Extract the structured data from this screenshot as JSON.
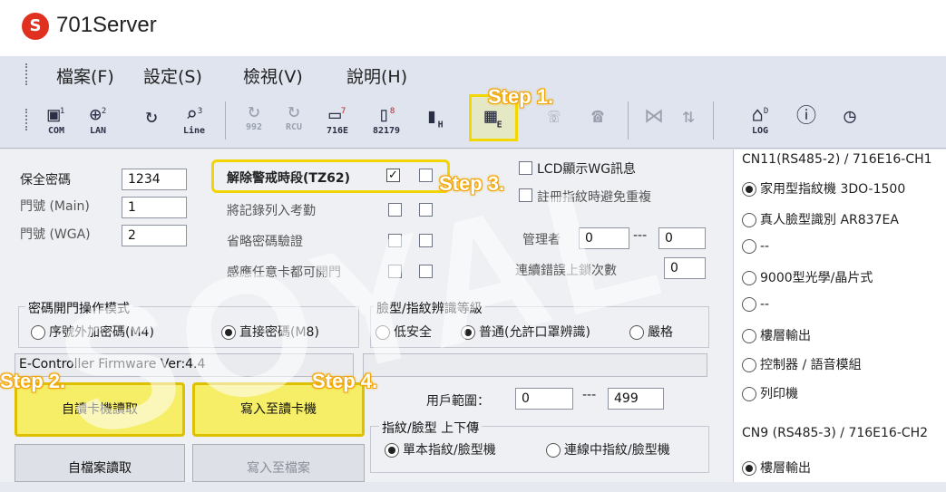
{
  "app": {
    "title": "701Server",
    "logo_letter": "S"
  },
  "menu": [
    "檔案(F)",
    "設定(S)",
    "檢視(V)",
    "說明(H)"
  ],
  "toolbar": {
    "com": {
      "label": "COM",
      "badge": "1"
    },
    "lan": {
      "label": "LAN",
      "badge": "2"
    },
    "line": {
      "label": "Line",
      "badge": "3"
    },
    "b992": {
      "label": "992"
    },
    "rcu": {
      "label": "RCU"
    },
    "e716": {
      "label": "716E",
      "badge": "7"
    },
    "e82179": {
      "label": "82179",
      "badge": "8"
    },
    "h_badge": "H",
    "e_badge": "E",
    "log": {
      "label": "LOG",
      "badge": "D"
    }
  },
  "steps": {
    "step1": "Step 1.",
    "step2": "Step 2.",
    "step3": "Step 3.",
    "step4": "Step 4."
  },
  "form": {
    "password_label": "保全密碼",
    "password_value": "1234",
    "door_main_label": "門號 (Main)",
    "door_main_value": "1",
    "door_wga_label": "門號 (WGA)",
    "door_wga_value": "2",
    "opt_disarm": "解除警戒時段(TZ62)",
    "opt_attendance": "將記錄列入考勤",
    "opt_skip_pwd": "省略密碼驗證",
    "opt_any_card": "感應任意卡都可開門",
    "lcd_wg": "LCD顯示WG訊息",
    "no_dup_fp": "註冊指紋時避免重複",
    "admin_label": "管理者",
    "admin_from": "0",
    "admin_to": "0",
    "range_sep": "---",
    "lock_label": "連續錯誤上鎖次數",
    "lock_value": "0"
  },
  "pwd_mode": {
    "title": "密碼開門操作模式",
    "opt1": "序號外加密碼(M4)",
    "opt2": "直接密碼(M8)",
    "selected": "opt2"
  },
  "face_level": {
    "title": "臉型/指紋辨識等級",
    "low": "低安全",
    "normal": "普通(允許口罩辨識)",
    "strict": "嚴格",
    "selected": "normal"
  },
  "firmware": "E-Controller Firmware Ver:4.4",
  "buttons": {
    "read_from_reader": "自讀卡機讀取",
    "write_to_reader": "寫入至讀卡機",
    "read_from_file": "自檔案讀取",
    "write_to_file": "寫入至檔案"
  },
  "user_range": {
    "label": "用戶範圍：",
    "from": "0",
    "sep": "---",
    "to": "499"
  },
  "transfer": {
    "title": "指紋/臉型 上下傳",
    "single": "單本指紋/臉型機",
    "online": "連線中指紋/臉型機",
    "selected": "single"
  },
  "right_panel": {
    "cn11_title": "CN11(RS485-2) / 716E16-CH1",
    "cn11_options": [
      "家用型指紋機 3DO-1500",
      "真人臉型識別 AR837EA",
      "--",
      "9000型光學/晶片式",
      "--",
      "樓層輸出",
      "控制器 / 語音模組",
      "列印機"
    ],
    "cn11_selected": 0,
    "cn9_title": "CN9 (RS485-3) / 716E16-CH2",
    "cn9_options": [
      "樓層輸出"
    ],
    "cn9_selected": 0
  },
  "watermark": "SOYAL",
  "colors": {
    "highlight": "#f1d400",
    "button_highlight": "#f6ee66",
    "step_text": "#f2a500",
    "logo": "#e03020"
  }
}
